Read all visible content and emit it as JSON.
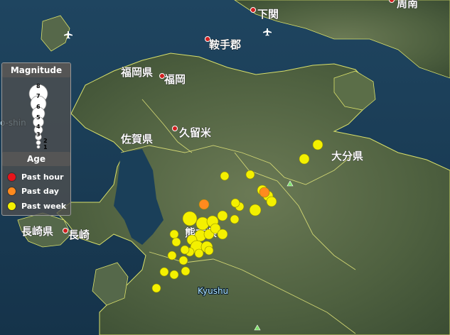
{
  "map": {
    "place_labels": {
      "shimonoseki": "下関",
      "shunan": "周南",
      "kurate": "鞍手郡",
      "fukuoka_pref": "福岡県",
      "fukuoka": "福岡",
      "kurume": "久留米",
      "saga_pref": "佐賀県",
      "oita_pref": "大分県",
      "kumamoto_pref": "熊本県",
      "nagasaki_pref": "長崎県",
      "nagasaki": "長崎",
      "kyushu": "Kyushu",
      "partial_left": "o-shin"
    }
  },
  "legend": {
    "magnitude_title": "Magnitude",
    "magnitude_scale": [
      "8",
      "7",
      "6",
      "5",
      "4",
      "3",
      "2",
      "1"
    ],
    "age_title": "Age",
    "age_items": [
      {
        "label": "Past hour",
        "color": "#e8141b"
      },
      {
        "label": "Past day",
        "color": "#ff8a1e"
      },
      {
        "label": "Past week",
        "color": "#f4f000"
      }
    ]
  },
  "colors": {
    "past_week": "#f4f000",
    "past_day": "#ff8a1e",
    "past_hour": "#e8141b",
    "sea": "#1b3a52",
    "land": "#4a5e3a"
  }
}
